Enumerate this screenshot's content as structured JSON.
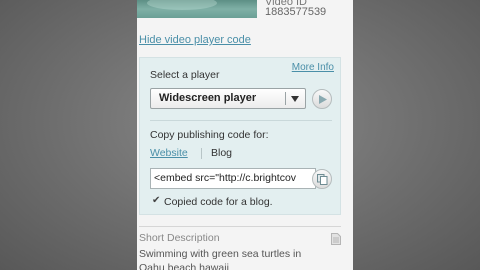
{
  "video": {
    "id_label": "Video ID",
    "id_value": "1883577539"
  },
  "hide_player_code_link": "Hide video player code",
  "player_box": {
    "more_info_link": "More Info",
    "select_label": "Select a player",
    "selected_player": "Widescreen player",
    "copy_label": "Copy publishing code for:",
    "tabs": [
      {
        "label": "Website",
        "active": true
      },
      {
        "label": "Blog",
        "active": false
      }
    ],
    "code_value": "<embed src=\"http://c.brightcov",
    "copied_message": "Copied code for a blog."
  },
  "description": {
    "label": "Short Description",
    "text": "Swimming with green sea turtles in Oahu beach hawaii"
  },
  "colors": {
    "link": "#4a8fa8",
    "box_background": "#e3eff0",
    "panel_background": "#f4f4f4"
  },
  "icons": [
    "play-icon",
    "copy-icon",
    "checkmark-icon",
    "document-icon",
    "chevron-down-icon"
  ]
}
